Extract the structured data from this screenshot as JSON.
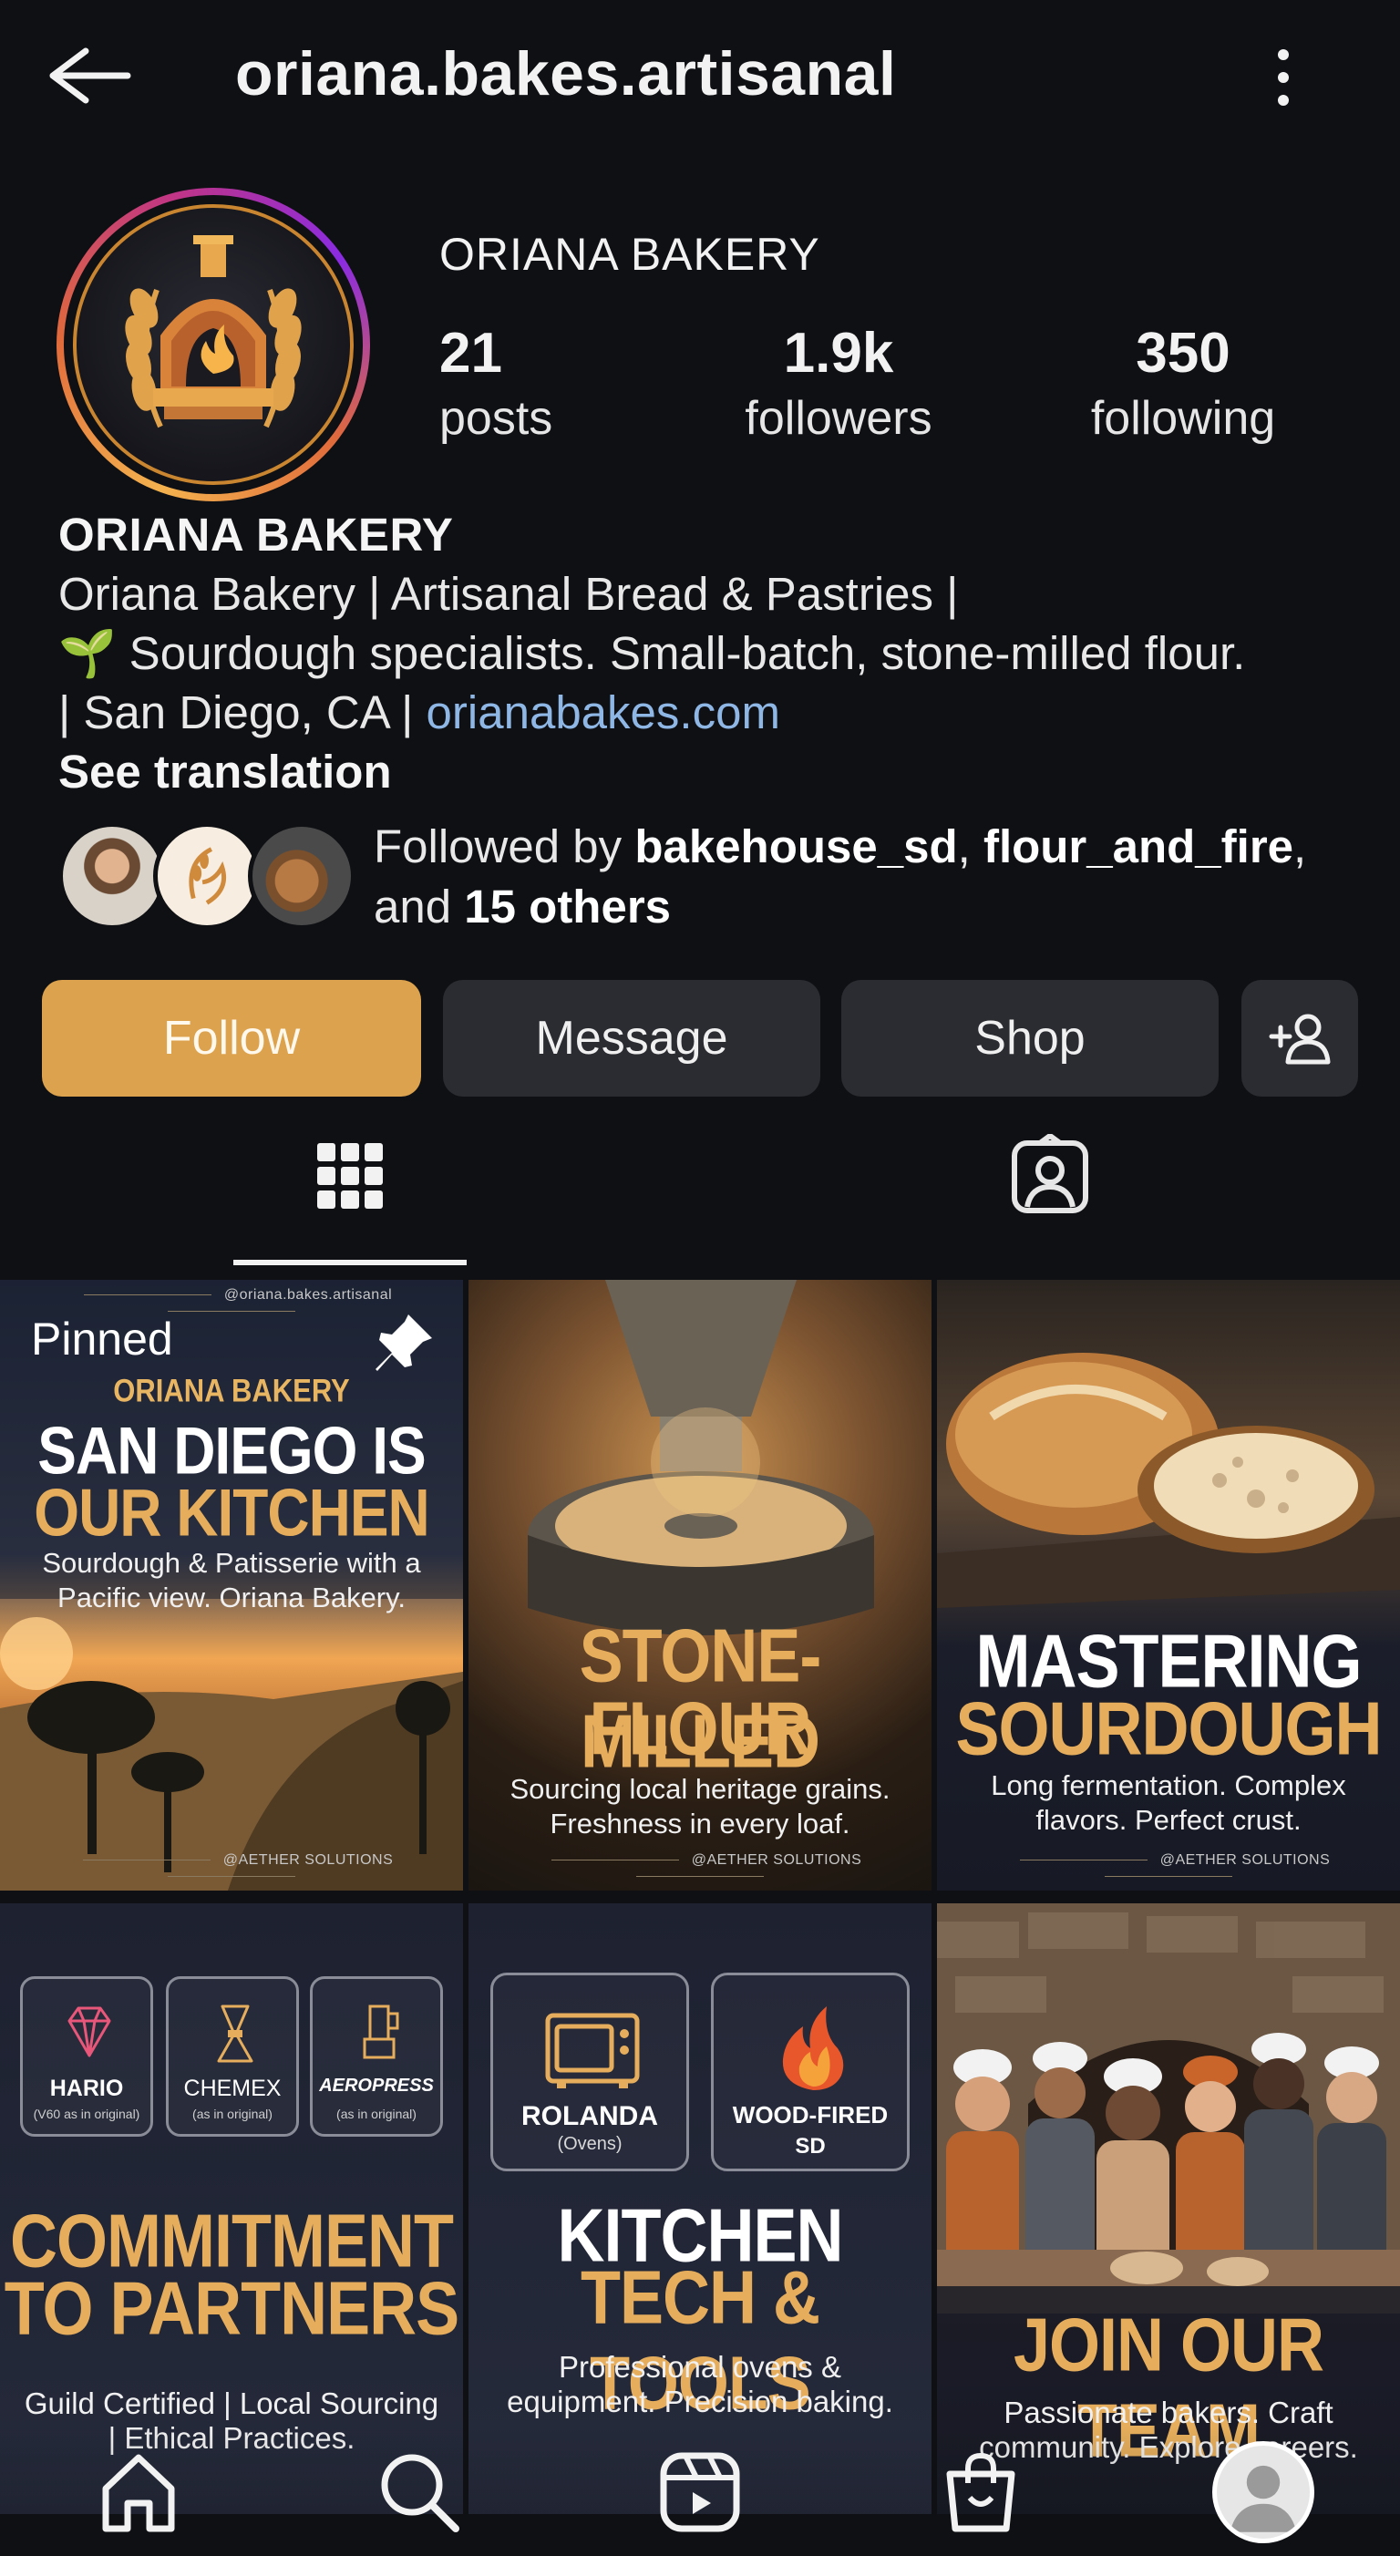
{
  "header": {
    "handle": "oriana.bakes.artisanal",
    "back_icon": "back-arrow-icon",
    "more_icon": "more-vertical-icon"
  },
  "profile": {
    "name": "ORIANA BAKERY",
    "stats": {
      "posts_value": "21",
      "posts_label": "posts",
      "followers_value": "1.9k",
      "followers_label": "followers",
      "following_value": "350",
      "following_label": "following"
    },
    "bio": {
      "name": "ORIANA BAKERY",
      "line1": "Oriana Bakery | Artisanal Bread & Pastries |",
      "line2_emoji": "🌱",
      "line2": " Sourdough specialists. Small-batch, stone-milled flour.",
      "line3": "| San Diego, CA | ",
      "link": "orianabakes.com",
      "see_translation": "See translation"
    },
    "followed_by": {
      "prefix": "Followed by ",
      "user1": "bakehouse_sd",
      "sep": ", ",
      "user2": "flour_and_fire",
      "mid": ",",
      "and": "and ",
      "others": "15 others"
    }
  },
  "actions": {
    "follow": "Follow",
    "message": "Message",
    "shop": "Shop",
    "add_user_icon": "add-user-icon",
    "follow_color": "#dda24d"
  },
  "tabs": {
    "grid_icon": "grid-icon",
    "tagged_icon": "tagged-icon",
    "active": "grid"
  },
  "posts": [
    {
      "tag_top": "@oriana.bakes.artisanal",
      "pinned": "Pinned",
      "kicker": "ORIANA BAKERY",
      "headline1": "SAN DIEGO IS",
      "headline2": "OUR KITCHEN",
      "sub": "Sourdough & Patisserie with a Pacific view. Oriana Bakery.",
      "tag_bottom": "@AETHER SOLUTIONS"
    },
    {
      "headline1": "STONE-MILLED",
      "headline2": "FLOUR",
      "sub": "Sourcing local heritage grains. Freshness in every loaf.",
      "tag_bottom": "@AETHER SOLUTIONS"
    },
    {
      "headline1": "MASTERING",
      "headline2": "SOURDOUGH",
      "sub": "Long fermentation. Complex flavors. Perfect crust.",
      "tag_bottom": "@AETHER SOLUTIONS"
    },
    {
      "partners": [
        {
          "name": "HARIO",
          "note": "(V60 as in original)"
        },
        {
          "name": "CHEMEX",
          "note": "(as in original)"
        },
        {
          "name": "AEROPRESS",
          "note": "(as in original)"
        }
      ],
      "headline1": "COMMITMENT",
      "headline2": "TO PARTNERS",
      "sub": "Guild Certified | Local Sourcing | Ethical Practices."
    },
    {
      "tools": [
        {
          "name": "ROLANDA",
          "note": "(Ovens)"
        },
        {
          "name": "WOOD-FIRED",
          "note": "SD"
        }
      ],
      "headline1": "KITCHEN",
      "headline2": "TECH & TOOLS",
      "sub": "Professional ovens & equipment. Precision baking."
    },
    {
      "headline1": "JOIN OUR TEAM",
      "sub": "Passionate bakers. Craft community. Explore careers."
    }
  ],
  "bottom_nav": {
    "items": [
      "home-icon",
      "search-icon",
      "reels-icon",
      "shop-icon",
      "profile-avatar"
    ]
  }
}
